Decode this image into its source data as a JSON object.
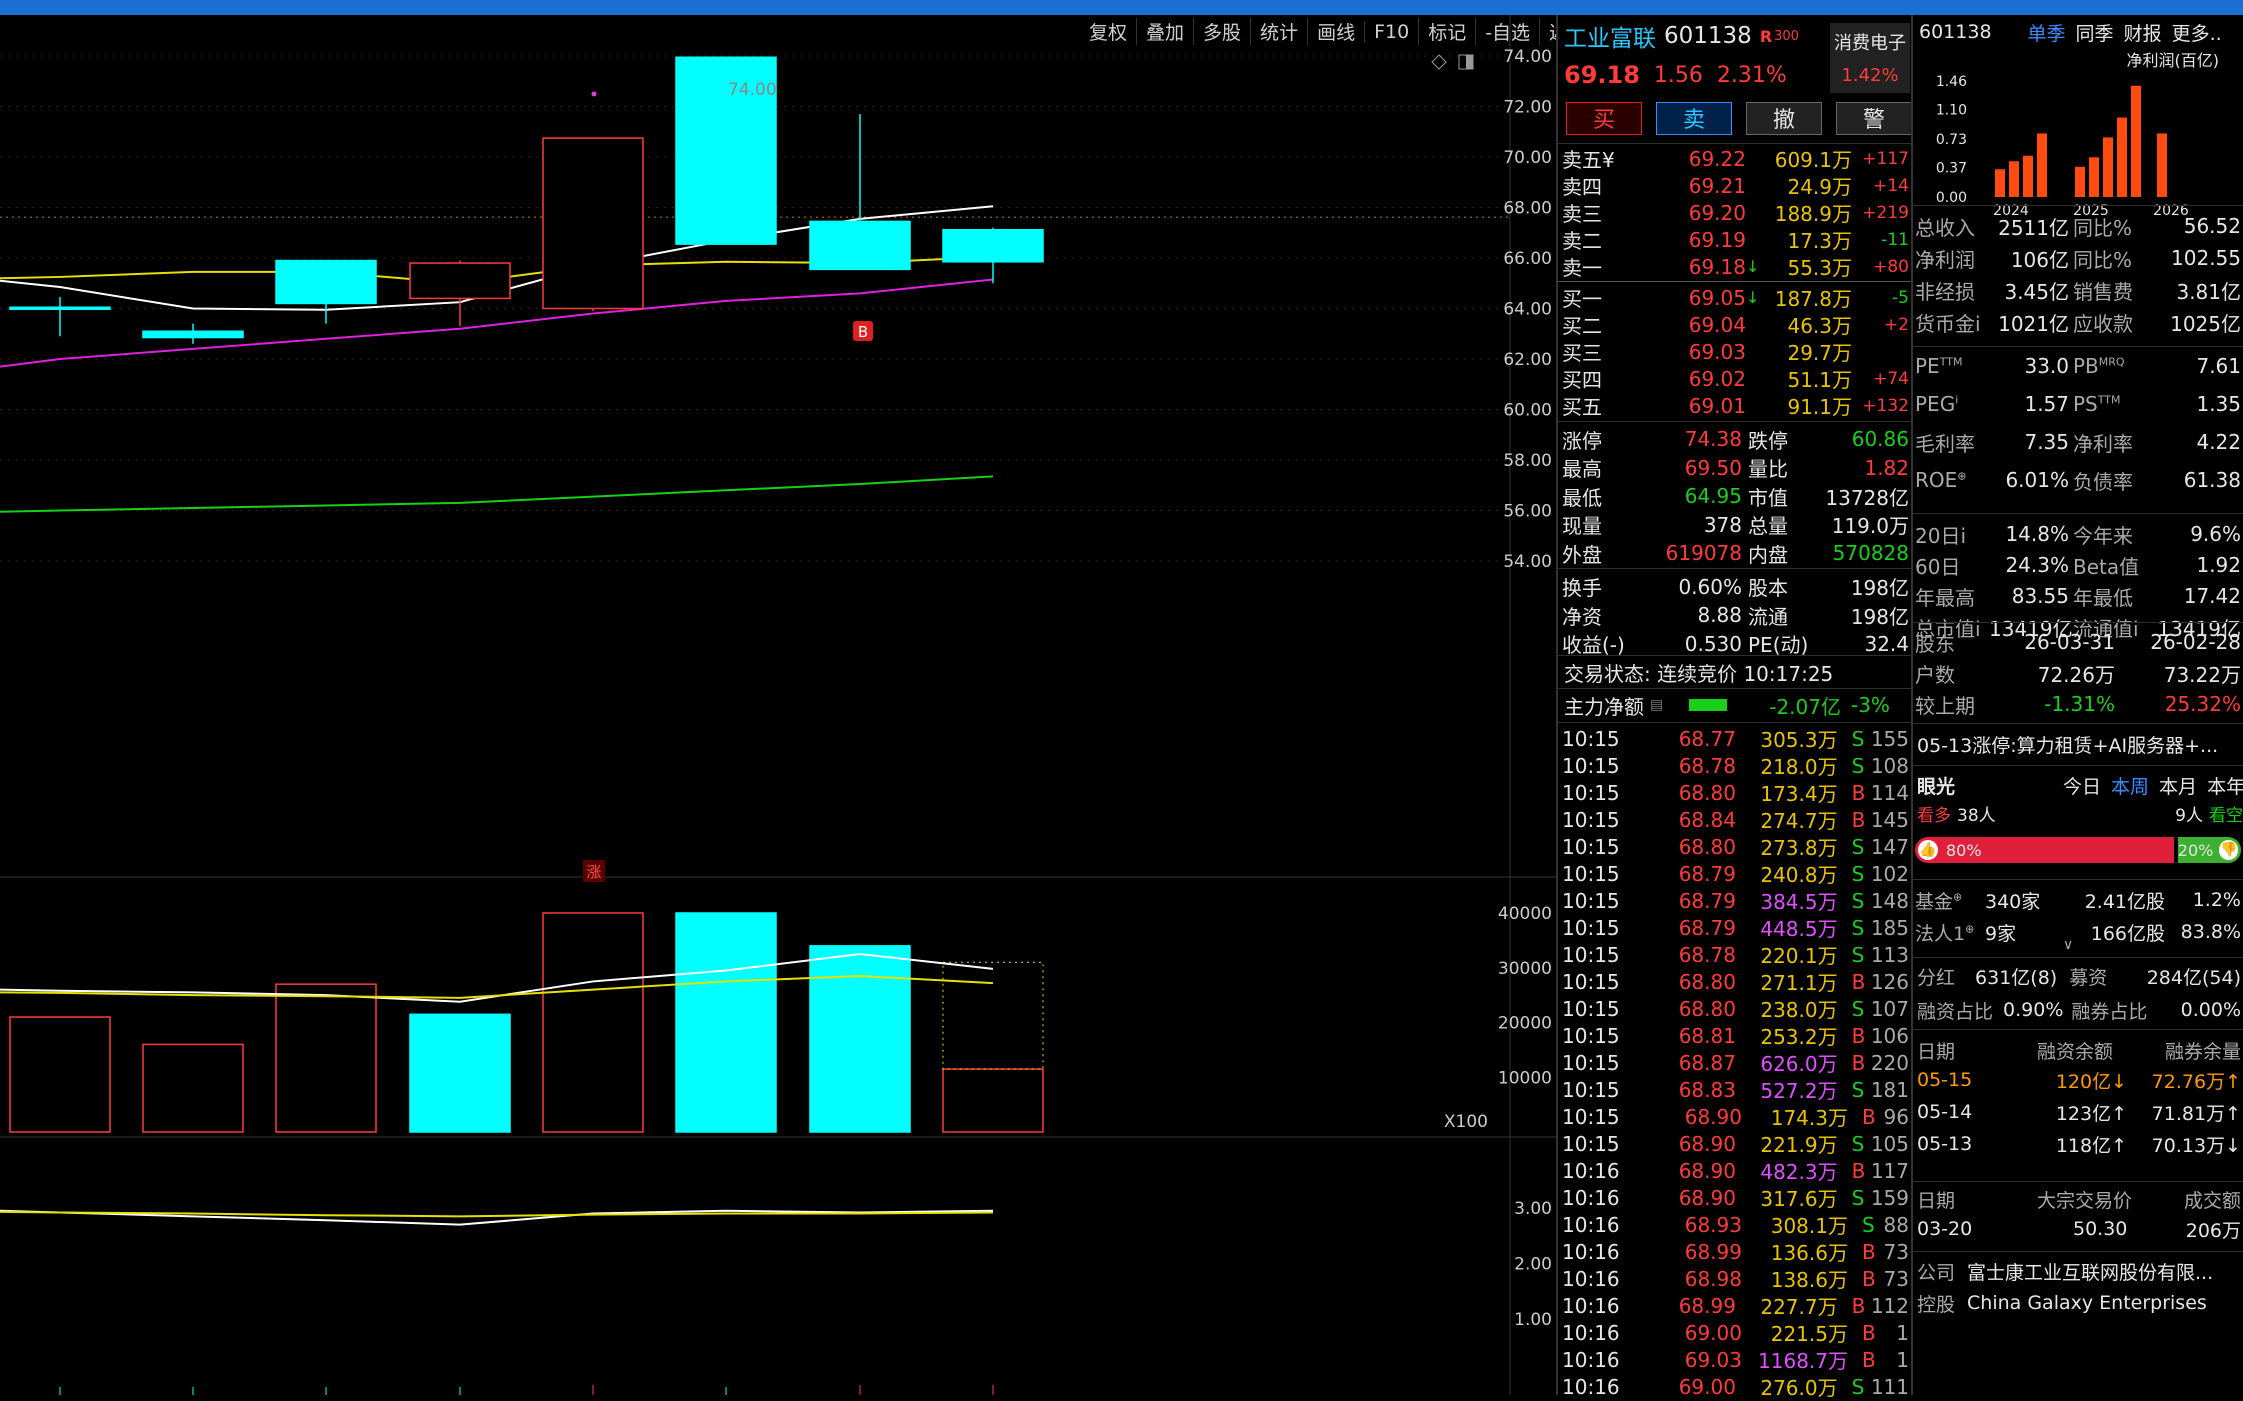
{
  "toolbar": [
    "复权",
    "叠加",
    "多股",
    "统计",
    "画线",
    "F10",
    "标记",
    "-自选",
    "返回"
  ],
  "price_axis": [
    "74.00",
    "72.00",
    "70.00",
    "68.00",
    "66.00",
    "64.00",
    "62.00",
    "60.00",
    "58.00",
    "56.00",
    "54.00"
  ],
  "vol_axis": [
    "40000",
    "30000",
    "20000",
    "10000"
  ],
  "vol_unit": "X100",
  "ind_axis": [
    "3.00",
    "2.00",
    "1.00"
  ],
  "chart_label_high": "74.00",
  "marker_b": "B",
  "marker_zhang": "涨",
  "quote": {
    "name": "工业富联",
    "code": "601138",
    "tag": "R",
    "tag2": "300",
    "sector": "消费电子",
    "sector_pct": "1.42%",
    "price": "69.18",
    "change": "1.56",
    "pct": "2.31%",
    "buttons": [
      "买",
      "卖",
      "撤",
      "警"
    ]
  },
  "asks": [
    {
      "label": "卖五",
      "mark": "¥",
      "price": "69.22",
      "vol": "609.1万",
      "delta": "+117"
    },
    {
      "label": "卖四",
      "mark": "",
      "price": "69.21",
      "vol": "24.9万",
      "delta": "+14"
    },
    {
      "label": "卖三",
      "mark": "",
      "price": "69.20",
      "vol": "188.9万",
      "delta": "+219"
    },
    {
      "label": "卖二",
      "mark": "",
      "price": "69.19",
      "vol": "17.3万",
      "delta": "-11"
    },
    {
      "label": "卖一",
      "mark": "",
      "price": "69.18",
      "arrow": "↓",
      "vol": "55.3万",
      "delta": "+80"
    }
  ],
  "bids": [
    {
      "label": "买一",
      "price": "69.05",
      "arrow": "↓",
      "vol": "187.8万",
      "delta": "-5"
    },
    {
      "label": "买二",
      "price": "69.04",
      "vol": "46.3万",
      "delta": "+2"
    },
    {
      "label": "买三",
      "price": "69.03",
      "vol": "29.7万",
      "delta": ""
    },
    {
      "label": "买四",
      "price": "69.02",
      "vol": "51.1万",
      "delta": "+74"
    },
    {
      "label": "买五",
      "price": "69.01",
      "vol": "91.1万",
      "delta": "+132"
    }
  ],
  "stats": [
    {
      "k1": "涨停",
      "v1": "74.38",
      "c1": "red",
      "k2": "跌停",
      "v2": "60.86",
      "c2": "green"
    },
    {
      "k1": "最高",
      "v1": "69.50",
      "c1": "red",
      "k2": "量比",
      "v2": "1.82",
      "c2": "red"
    },
    {
      "k1": "最低",
      "v1": "64.95",
      "c1": "green",
      "k2": "市值",
      "v2": "13728亿",
      "c2": "white"
    },
    {
      "k1": "现量",
      "v1": "378",
      "c1": "white",
      "k2": "总量",
      "v2": "119.0万",
      "c2": "white"
    },
    {
      "k1": "外盘",
      "v1": "619078",
      "c1": "red",
      "k2": "内盘",
      "v2": "570828",
      "c2": "green"
    },
    {
      "k1": "换手",
      "v1": "0.60%",
      "c1": "white",
      "k2": "股本",
      "v2": "198亿",
      "c2": "white"
    },
    {
      "k1": "净资",
      "v1": "8.88",
      "c1": "white",
      "k2": "流通",
      "v2": "198亿",
      "c2": "white"
    },
    {
      "k1": "收益(-)",
      "v1": "0.530",
      "c1": "white",
      "k2": "PE(动)",
      "v2": "32.4",
      "c2": "white"
    }
  ],
  "trade_status": "交易状态: 连续竞价 10:17:25",
  "main_net": {
    "label": "主力净额",
    "value": "-2.07亿",
    "pct": "-3%"
  },
  "ticks": [
    {
      "t": "10:15",
      "p": "68.77",
      "v": "305.3万",
      "s": "S",
      "n": "155"
    },
    {
      "t": "10:15",
      "p": "68.78",
      "v": "218.0万",
      "s": "S",
      "n": "108"
    },
    {
      "t": "10:15",
      "p": "68.80",
      "v": "173.4万",
      "s": "B",
      "n": "114"
    },
    {
      "t": "10:15",
      "p": "68.84",
      "v": "274.7万",
      "s": "B",
      "n": "145"
    },
    {
      "t": "10:15",
      "p": "68.80",
      "v": "273.8万",
      "s": "S",
      "n": "147"
    },
    {
      "t": "10:15",
      "p": "68.79",
      "v": "240.8万",
      "s": "S",
      "n": "102"
    },
    {
      "t": "10:15",
      "p": "68.79",
      "v": "384.5万",
      "s": "S",
      "n": "148",
      "big": true
    },
    {
      "t": "10:15",
      "p": "68.79",
      "v": "448.5万",
      "s": "S",
      "n": "185",
      "big": true
    },
    {
      "t": "10:15",
      "p": "68.78",
      "v": "220.1万",
      "s": "S",
      "n": "113"
    },
    {
      "t": "10:15",
      "p": "68.80",
      "v": "271.1万",
      "s": "B",
      "n": "126"
    },
    {
      "t": "10:15",
      "p": "68.80",
      "v": "238.0万",
      "s": "S",
      "n": "107"
    },
    {
      "t": "10:15",
      "p": "68.81",
      "v": "253.2万",
      "s": "B",
      "n": "106"
    },
    {
      "t": "10:15",
      "p": "68.87",
      "v": "626.0万",
      "s": "B",
      "n": "220",
      "big": true
    },
    {
      "t": "10:15",
      "p": "68.83",
      "v": "527.2万",
      "s": "S",
      "n": "181",
      "big": true
    },
    {
      "t": "10:15",
      "p": "68.90",
      "v": "174.3万",
      "s": "B",
      "n": "96"
    },
    {
      "t": "10:15",
      "p": "68.90",
      "v": "221.9万",
      "s": "S",
      "n": "105"
    },
    {
      "t": "10:16",
      "p": "68.90",
      "v": "482.3万",
      "s": "B",
      "n": "117",
      "big": true
    },
    {
      "t": "10:16",
      "p": "68.90",
      "v": "317.6万",
      "s": "S",
      "n": "159"
    },
    {
      "t": "10:16",
      "p": "68.93",
      "v": "308.1万",
      "s": "S",
      "n": "88"
    },
    {
      "t": "10:16",
      "p": "68.99",
      "v": "136.6万",
      "s": "B",
      "n": "73"
    },
    {
      "t": "10:16",
      "p": "68.98",
      "v": "138.6万",
      "s": "B",
      "n": "73"
    },
    {
      "t": "10:16",
      "p": "68.99",
      "v": "227.7万",
      "s": "B",
      "n": "112"
    },
    {
      "t": "10:16",
      "p": "69.00",
      "v": "221.5万",
      "s": "B",
      "n": "1"
    },
    {
      "t": "10:16",
      "p": "69.03",
      "v": "1168.7万",
      "s": "B",
      "n": "1",
      "big": true
    },
    {
      "t": "10:16",
      "p": "69.00",
      "v": "276.0万",
      "s": "S",
      "n": "111"
    }
  ],
  "fin": {
    "code": "601138",
    "tabs": [
      "单季",
      "同季",
      "财报",
      "更多.."
    ],
    "chart_title": "净利润(百亿)",
    "chart_data": {
      "type": "bar",
      "title": "净利润(百亿)",
      "yticks": [
        "1.46",
        "1.10",
        "0.73",
        "0.37",
        "0.00"
      ],
      "ylim": [
        0,
        1.46
      ],
      "year_labels": [
        "2024",
        "2025",
        "2026"
      ],
      "values": [
        0.35,
        0.45,
        0.52,
        0.8,
        0.38,
        0.5,
        0.75,
        1.0,
        1.4,
        0.8
      ]
    },
    "rows1": [
      {
        "k1": "总收入",
        "v1": "2511亿",
        "k2": "同比%",
        "v2": "56.52"
      },
      {
        "k1": "净利润",
        "v1": "106亿",
        "k2": "同比%",
        "v2": "102.55"
      },
      {
        "k1": "非经损",
        "v1": "3.45亿",
        "k2": "销售费",
        "v2": "3.81亿"
      },
      {
        "k1": "货币金i",
        "v1": "1021亿",
        "k2": "应收款",
        "v2": "1025亿"
      }
    ],
    "rows2": [
      {
        "k1": "PE",
        "sup1": "TTM",
        "v1": "33.0",
        "k2": "PB",
        "sup2": "MRQ",
        "v2": "7.61"
      },
      {
        "k1": "PEG",
        "sup1": "i",
        "v1": "1.57",
        "k2": "PS",
        "sup2": "TTM",
        "v2": "1.35"
      },
      {
        "k1": "毛利率",
        "sup1": "",
        "v1": "7.35",
        "k2": "净利率",
        "sup2": "",
        "v2": "4.22"
      },
      {
        "k1": "ROE",
        "sup1": "⊕",
        "v1": "6.01%",
        "k2": "负债率",
        "sup2": "",
        "v2": "61.38"
      }
    ],
    "rows3": [
      {
        "k1": "20日i",
        "v1": "14.8%",
        "k2": "今年来",
        "v2": "9.6%"
      },
      {
        "k1": "60日",
        "v1": "24.3%",
        "k2": "Beta值",
        "v2": "1.92"
      },
      {
        "k1": "年最高",
        "v1": "83.55",
        "k2": "年最低",
        "v2": "17.42"
      },
      {
        "k1": "总市值i",
        "v1": "13419亿",
        "k2": "流通值i",
        "v2": "13419亿"
      }
    ],
    "holders": [
      {
        "k": "股东",
        "v1": "26-03-31",
        "v2": "26-02-28"
      },
      {
        "k": "户数",
        "v1": "72.26万",
        "v2": "73.22万"
      },
      {
        "k": "较上期",
        "v1": "-1.31%",
        "v2": "25.32%"
      }
    ],
    "news": "05-13涨停:算力租赁+AI服务器+...",
    "eye": {
      "title": "眼光",
      "tabs": [
        "今日",
        "本周",
        "本月",
        "本年"
      ],
      "bull": "看多",
      "bull_n": "38人",
      "bear_n": "9人",
      "bear": "看空",
      "bull_pct": "80%",
      "bear_pct": "20%",
      "bull_ratio": 0.8
    },
    "inst": [
      {
        "k": "基金",
        "sup": "⊕",
        "a": "340家",
        "b": "2.41亿股",
        "c": "1.2%"
      },
      {
        "k": "法人1",
        "sup": "⊕",
        "a": "9家",
        "b": "166亿股",
        "c": "83.8%"
      }
    ],
    "div": {
      "k": "分红",
      "v": "631亿(8)",
      "k2": "募资",
      "v2": "284亿(54)"
    },
    "margin_ratio": {
      "k": "融资占比",
      "v": "0.90%",
      "k2": "融券占比",
      "v2": "0.00%"
    },
    "margin_head": [
      "日期",
      "融资余额",
      "融券余量"
    ],
    "margin": [
      {
        "d": "05-15",
        "a": "120亿↓",
        "b": "72.76万↑",
        "hl": true
      },
      {
        "d": "05-14",
        "a": "123亿↑",
        "b": "71.81万↑",
        "hl": false
      },
      {
        "d": "05-13",
        "a": "118亿↑",
        "b": "70.13万↓",
        "hl": false
      }
    ],
    "block_head": [
      "日期",
      "大宗交易价",
      "成交额"
    ],
    "block": {
      "d": "03-20",
      "p": "50.30",
      "a": "206万"
    },
    "company": {
      "k": "公司",
      "v": "富士康工业互联网股份有限..."
    },
    "control": {
      "k": "控股",
      "v": "China Galaxy Enterprises"
    }
  },
  "colors": {
    "up": "#ff3b3b",
    "down": "#00ffff",
    "ma5": "#ffffff",
    "ma10": "#e8e000",
    "ma20": "#e020e0",
    "ma60": "#18d018"
  }
}
